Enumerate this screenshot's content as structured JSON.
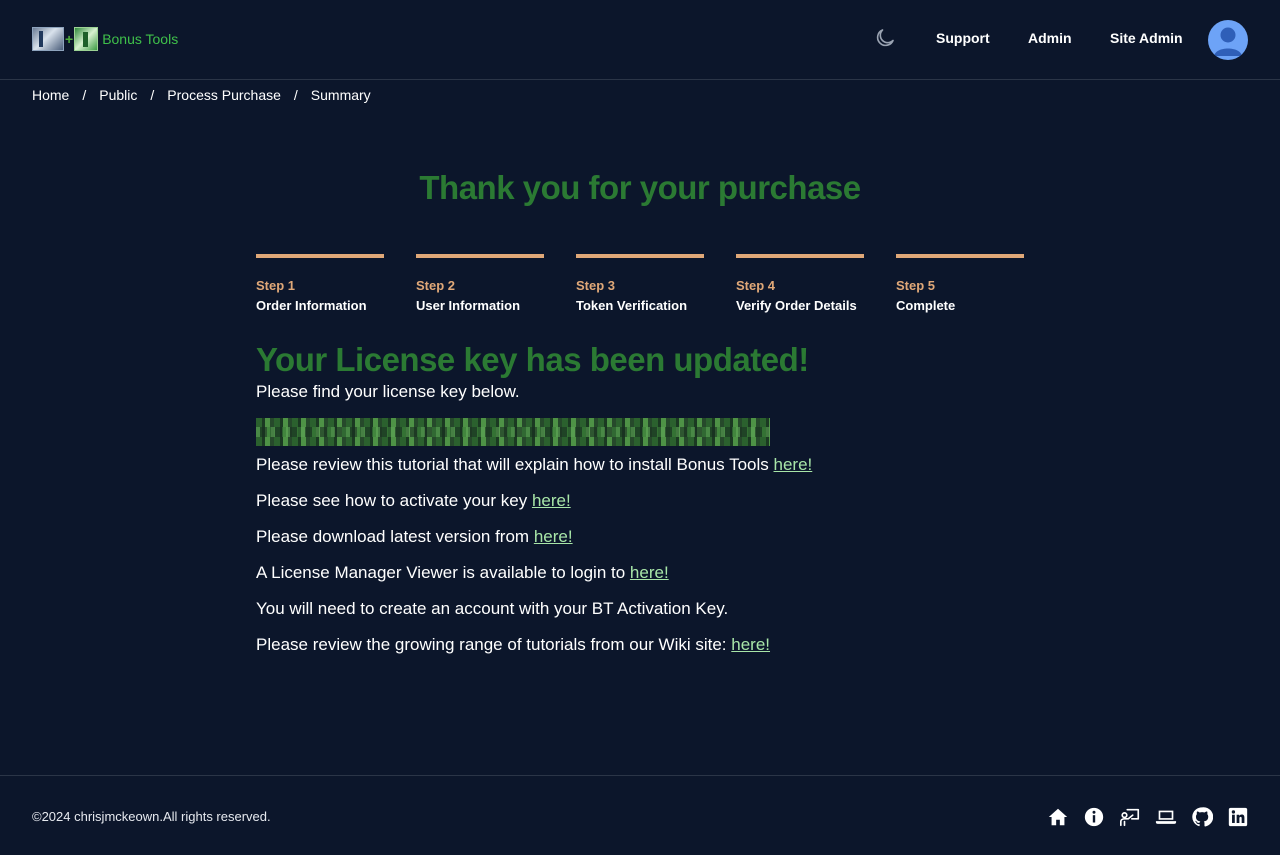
{
  "header": {
    "logo_text": "Bonus Tools",
    "nav": [
      {
        "label": "Support"
      },
      {
        "label": "Admin"
      },
      {
        "label": "Site Admin"
      }
    ]
  },
  "breadcrumb": [
    "Home",
    "Public",
    "Process Purchase",
    "Summary"
  ],
  "hero": {
    "title": "Thank you for your purchase"
  },
  "steps": [
    {
      "num": "Step 1",
      "label": "Order Information"
    },
    {
      "num": "Step 2",
      "label": "User Information"
    },
    {
      "num": "Step 3",
      "label": "Token Verification"
    },
    {
      "num": "Step 4",
      "label": "Verify Order Details"
    },
    {
      "num": "Step 5",
      "label": "Complete"
    }
  ],
  "content": {
    "title": "Your License key has been updated!",
    "find_key": "Please find your license key below.",
    "tutorial": "Please review this tutorial that will explain how to install Bonus Tools",
    "activate": "Please see how to activate your key",
    "download": "Please download latest version from",
    "viewer": "A License Manager Viewer is available to login to",
    "account": "You will need to create an account with your BT Activation Key.",
    "wiki": "Please review the growing range of tutorials from our Wiki site:",
    "link_label": "here!"
  },
  "footer": {
    "copyright": "©2024 chrisjmckeown.All rights reserved."
  },
  "icons": [
    "moon-icon",
    "avatar-icon",
    "home-icon",
    "info-icon",
    "presentation-icon",
    "laptop-icon",
    "github-icon",
    "linkedin-icon"
  ],
  "colors": {
    "background": "#0c162b",
    "heading_green": "#2b7a33",
    "step_accent": "#e0a878",
    "link": "#a8e6a8",
    "logo_green": "#3fc04a",
    "avatar_blue": "#6da3f7"
  }
}
